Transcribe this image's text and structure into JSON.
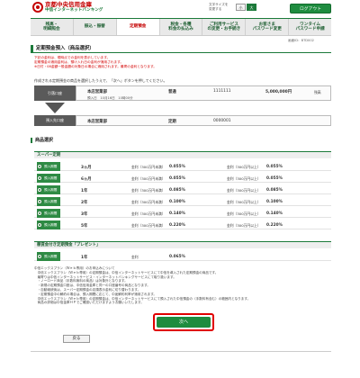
{
  "header": {
    "bank_name": "京都中央信用金庫",
    "service_name": "中信インターネットバンキング",
    "font_size_label": "文字サイズを\n変更する",
    "font_small": "小",
    "font_large": "大",
    "logout": "ログアウト"
  },
  "nav": [
    {
      "label": "残高・\n明細照会",
      "active": false
    },
    {
      "label": "振込・振替",
      "active": false
    },
    {
      "label": "定期預金",
      "active": true
    },
    {
      "label": "税金・各種\n料金の払込み",
      "active": false
    },
    {
      "label": "ご利用サービス\nの変更・お手続き",
      "active": false
    },
    {
      "label": "お客さま\nパスワード変更",
      "active": false
    },
    {
      "label": "ワンタイム\nパスワード申請",
      "active": false
    }
  ],
  "screen_id": "画面ID：BTD002",
  "page_title": "定期預金預入（商品選択）",
  "notice_lines": [
    "下記の金利は、現時点での金利を表示しています。",
    "定期預金の適用金利は、預け入れ日の金利が適用されます。",
    "※日付・08金額一般金額の対象日の場合に適用されます。最寄の金利となります。"
  ],
  "instruction": "作成される定期預金の商品を選択したうえで、「次へ」ボタンを押してください。",
  "source_account": {
    "label": "引落口座",
    "branch": "本店営業部",
    "type": "普通",
    "number": "1111111",
    "balance": "5,000,000円",
    "balance_unit": "残高",
    "payment_date": "預入日　10月16日　10時00分"
  },
  "dest_account": {
    "label": "預入先口座",
    "branch": "本店営業部",
    "type": "定期",
    "number": "0000001"
  },
  "product_section_title": "商品選択",
  "super_title": "スーパー定期",
  "products": [
    {
      "badge": "預入期間",
      "term": "3ヵ月",
      "cond1": "金利（300万円未満）",
      "rate1": "0.055%",
      "cond2": "金利（300万円以上）",
      "rate2": "0.055%"
    },
    {
      "badge": "預入期間",
      "term": "6ヵ月",
      "cond1": "金利（300万円未満）",
      "rate1": "0.055%",
      "cond2": "金利（300万円以上）",
      "rate2": "0.055%"
    },
    {
      "badge": "預入期間",
      "term": "1年",
      "cond1": "金利（300万円未満）",
      "rate1": "0.085%",
      "cond2": "金利（300万円以上）",
      "rate2": "0.085%"
    },
    {
      "badge": "預入期間",
      "term": "2年",
      "cond1": "金利（300万円未満）",
      "rate1": "0.100%",
      "cond2": "金利（300万円以上）",
      "rate2": "0.100%"
    },
    {
      "badge": "預入期間",
      "term": "3年",
      "cond1": "金利（300万円未満）",
      "rate1": "0.140%",
      "cond2": "金利（300万円以上）",
      "rate2": "0.140%"
    },
    {
      "badge": "預入期間",
      "term": "5年",
      "cond1": "金利（300万円未満）",
      "rate1": "0.220%",
      "cond2": "金利（300万円以上）",
      "rate2": "0.220%"
    }
  ],
  "present_title": "懸賞金付き定期預金「プレゼント」",
  "present_product": {
    "badge": "預入期間",
    "term": "1年",
    "cond1": "金利",
    "rate1": "0.065%"
  },
  "notes": [
    "中信エックスプラン（Ｗｅｂ専用）のお申込みについて",
    "　中信エックスプラン（Ｗｅｂ専用）の定期預金は、中信インターネットサービスにて中信を導入された定期預金の商品です。",
    "　最寄りは中信インターネットサービス・インターネットバンキングサービスにて取り扱います。",
    "　・ノーロード商品（手数料無料の商品）は対象外となります。",
    "　・新規の定期預金口座は、中信信用金庫と同一の口座番号の商品となります。",
    "　・自動継続後は、スーパー定期預金の店頭表示金利に切り替わります。",
    "　・定期預金中の解約の場合は、預入期間に応じて、中途解約利率が適用されます。",
    "　中信エックスプラン（Ｗｅｂ専用）の定期預金は、中信インターネットサービスにて預入された中信預金の（手数料有含む）の範囲内となります。",
    "　商品の詳細は中信金庫ＨＰでご確認いただけますようお願いいたします。"
  ],
  "next_button": "次へ",
  "back_button": "戻る"
}
